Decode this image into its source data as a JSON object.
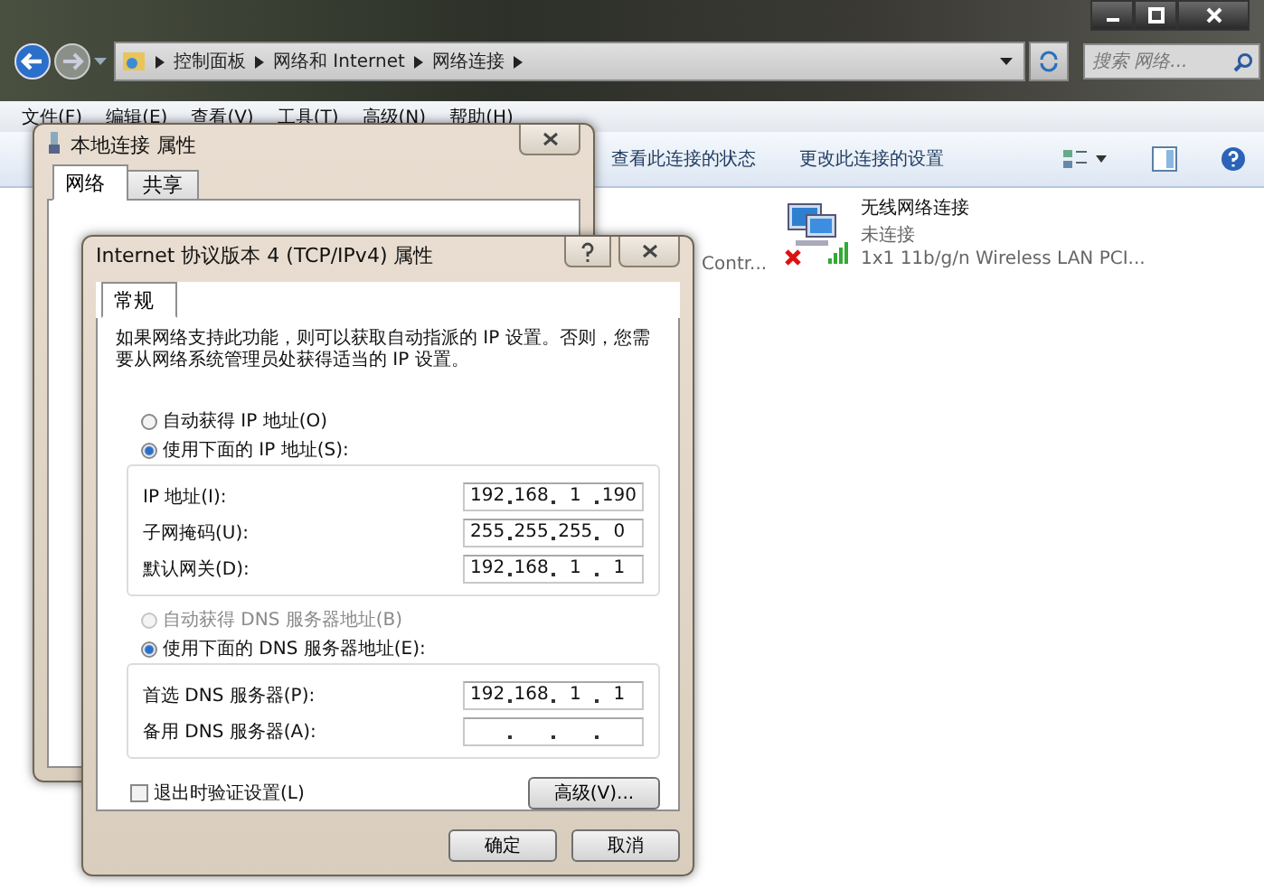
{
  "explorer": {
    "breadcrumb": [
      "控制面板",
      "网络和 Internet",
      "网络连接"
    ],
    "search": {
      "placeholder": "搜索 网络..."
    },
    "menu": [
      "文件(F)",
      "编辑(E)",
      "查看(V)",
      "工具(T)",
      "高级(N)",
      "帮助(H)"
    ],
    "toolbar": [
      "查看此连接的状态",
      "更改此连接的设置"
    ],
    "partial_item": "Contr...",
    "connections": [
      {
        "name": "无线网络连接",
        "status": "未连接",
        "device": "1x1 11b/g/n Wireless LAN PCI...",
        "connected": false
      }
    ]
  },
  "local_dialog": {
    "title": "本地连接 属性",
    "tabs": [
      {
        "label": "网络",
        "selected": true
      },
      {
        "label": "共享",
        "selected": false
      }
    ]
  },
  "ipv4_dialog": {
    "title": "Internet 协议版本 4 (TCP/IPv4) 属性",
    "tabs": [
      {
        "label": "常规",
        "selected": true
      }
    ],
    "intro": "如果网络支持此功能，则可以获取自动指派的 IP 设置。否则，您需要从网络系统管理员处获得适当的 IP 设置。",
    "ip_mode": [
      {
        "label": "自动获得 IP 地址(O)",
        "selected": false,
        "disabled": false
      },
      {
        "label": "使用下面的 IP 地址(S):",
        "selected": true,
        "disabled": false
      }
    ],
    "ip_fields": [
      {
        "label": "IP 地址(I):",
        "octets": [
          "192",
          "168",
          "1",
          "190"
        ]
      },
      {
        "label": "子网掩码(U):",
        "octets": [
          "255",
          "255",
          "255",
          "0"
        ]
      },
      {
        "label": "默认网关(D):",
        "octets": [
          "192",
          "168",
          "1",
          "1"
        ]
      }
    ],
    "dns_mode": [
      {
        "label": "自动获得 DNS 服务器地址(B)",
        "selected": false,
        "disabled": true
      },
      {
        "label": "使用下面的 DNS 服务器地址(E):",
        "selected": true,
        "disabled": false
      }
    ],
    "dns_fields": [
      {
        "label": "首选 DNS 服务器(P):",
        "octets": [
          "192",
          "168",
          "1",
          "1"
        ]
      },
      {
        "label": "备用 DNS 服务器(A):"
      }
    ],
    "validate_on_exit": {
      "label": "退出时验证设置(L)",
      "checked": false
    },
    "advanced_button": "高级(V)...",
    "buttons": [
      "确定",
      "取消"
    ]
  }
}
